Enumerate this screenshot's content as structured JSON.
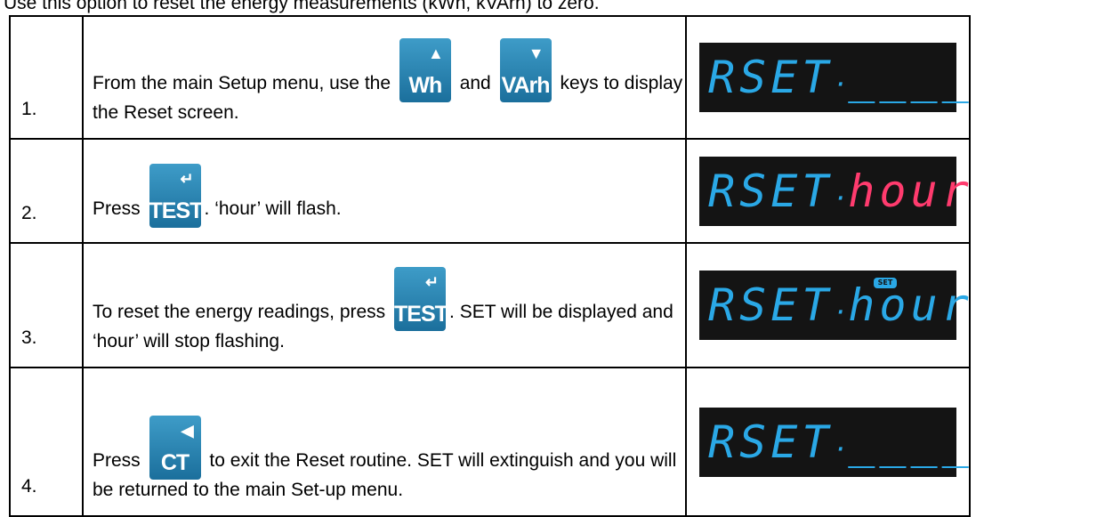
{
  "intro": "Use this option to reset the energy measurements (kWh, kVArh) to zero.",
  "keys": {
    "wh": {
      "label": "Wh",
      "arrow": "▲"
    },
    "varh": {
      "label": "VArh",
      "arrow": "▼"
    },
    "test": {
      "label": "TEST",
      "arrow": "↵"
    },
    "ct": {
      "label": "CT",
      "arrow": "◀"
    }
  },
  "steps": [
    {
      "num": "1.",
      "text_a": "From the main Setup menu, use the",
      "text_b": "and",
      "text_c": "keys to display the Reset screen.",
      "display": {
        "word1": "RSET",
        "sep": "·",
        "word2": "____",
        "badge": ""
      }
    },
    {
      "num": "2.",
      "text_a": "Press",
      "text_b": ".  ‘hour’ will flash.",
      "display": {
        "word1": "RSET",
        "sep": "·",
        "word2": "hour",
        "badge": ""
      }
    },
    {
      "num": "3.",
      "text_a": "To reset the energy readings, press",
      "text_b": ".  SET will be displayed and ‘hour’ will stop flashing.",
      "display": {
        "word1": "RSET",
        "sep": "·",
        "word2": "hour",
        "badge": "SET"
      }
    },
    {
      "num": "4.",
      "text_a": "Press",
      "text_b": "to exit the Reset routine.  SET will extinguish and you will be returned to the main Set-up menu.",
      "display": {
        "word1": "RSET",
        "sep": "·",
        "word2": "____",
        "badge": ""
      }
    }
  ],
  "colors": {
    "lcd_background": "#141414",
    "lcd_blue": "#2aa8e6",
    "lcd_pink": "#ff3b6e",
    "key_blue": "#1b6f9c"
  }
}
